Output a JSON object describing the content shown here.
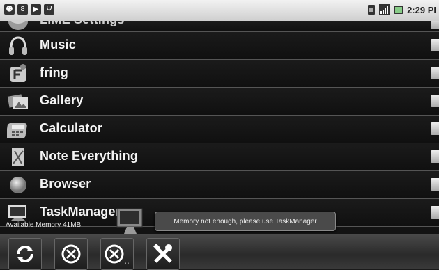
{
  "status_bar": {
    "time": "2:29 PI",
    "left_icons": [
      "notification-icon",
      "user-icon",
      "flag-icon",
      "usb-icon"
    ],
    "right_icons": [
      "sim-icon",
      "signal-icon",
      "battery-icon"
    ]
  },
  "apps": [
    {
      "label": "LIME Settings",
      "icon": "keyboard-icon"
    },
    {
      "label": "Music",
      "icon": "headphones-icon"
    },
    {
      "label": "fring",
      "icon": "fring-icon"
    },
    {
      "label": "Gallery",
      "icon": "gallery-icon"
    },
    {
      "label": "Calculator",
      "icon": "calculator-icon"
    },
    {
      "label": "Note Everything",
      "icon": "note-icon"
    },
    {
      "label": "Browser",
      "icon": "globe-icon"
    },
    {
      "label": "TaskManager",
      "icon": "monitor-icon"
    }
  ],
  "available_memory": "Available Memory 41MB",
  "toast_message": "Memory not enough, please use TaskManager",
  "toolbar": {
    "buttons": [
      "refresh",
      "kill",
      "kill-all",
      "settings"
    ],
    "kill_all_suffix": ".."
  },
  "colors": {
    "text": "#f4f4f4",
    "background": "#131313",
    "divider": "#555555"
  }
}
